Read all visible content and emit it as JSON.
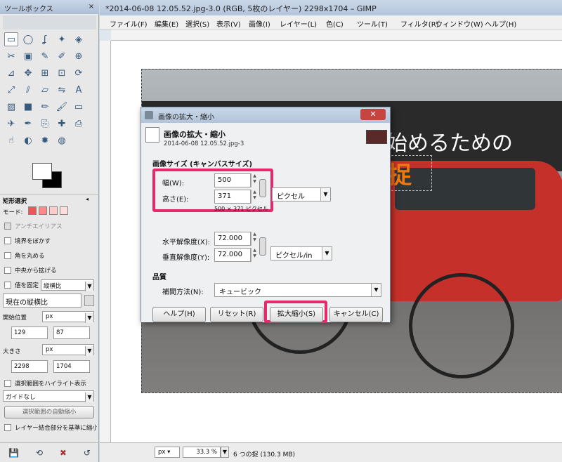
{
  "toolbox": {
    "title": "ツールボックス",
    "close": "×",
    "tools": [
      "rect-select",
      "ellipse-select",
      "free-select",
      "fuzzy-select",
      "color-select",
      "scissors-select",
      "foreground-select",
      "paths",
      "color-picker",
      "zoom",
      "measure",
      "move",
      "align",
      "crop",
      "rotate",
      "scale",
      "shear",
      "perspective",
      "flip",
      "text",
      "bucket-fill",
      "blend",
      "pencil",
      "paintbrush",
      "eraser",
      "airbrush",
      "ink",
      "clone",
      "heal",
      "perspective-clone",
      "smudge",
      "dodge-burn",
      "convolve",
      "blur"
    ],
    "options": {
      "title": "矩形選択",
      "mode_label": "モード:",
      "antialias": "アンチエイリアス",
      "feather": "境界をぼかす",
      "round": "角を丸める",
      "expand_center": "中央から拡げる",
      "fixed": "値を固定",
      "fixed_value": "縦横比",
      "current_ratio": "現在の縦横比",
      "position_label": "開始位置",
      "position_unit": "px",
      "pos_x": "129",
      "pos_y": "87",
      "size_label": "大きさ",
      "size_unit": "px",
      "size_w": "2298",
      "size_h": "1704",
      "highlight": "選択範囲をハイライト表示",
      "guides": "ガイドなし",
      "auto_shrink": "選択範囲の自動縮小",
      "merged": "レイヤー結合部分を基準に縮小"
    }
  },
  "gimp": {
    "title": "*2014-06-08 12.05.52.jpg-3.0 (RGB, 5枚のレイヤー) 2298x1704 – GIMP",
    "menus": [
      "ファイル(F)",
      "編集(E)",
      "選択(S)",
      "表示(V)",
      "画像(I)",
      "レイヤー(L)",
      "色(C)",
      "ツール(T)",
      "フィルタ(R)",
      "ウィンドウ(W)",
      "ヘルプ(H)"
    ],
    "canvas_text_white": "始めるための",
    "canvas_text_orange": "捉",
    "status": {
      "unit": "px",
      "zoom": "33.3 %",
      "info": "6 つの捉 (130.3 MB)"
    }
  },
  "dialog": {
    "title": "画像の拡大・縮小",
    "close": "✕",
    "header": "画像の拡大・縮小",
    "subtitle": "2014-06-08 12.05.52.jpg-3",
    "size_section": "画像サイズ (キャンバスサイズ)",
    "width_label": "幅(W):",
    "width_value": "500",
    "height_label": "高さ(E):",
    "height_value": "371",
    "size_hint": "500 × 371 ピクセル",
    "size_unit": "ピクセル",
    "xres_label": "水平解像度(X):",
    "xres_value": "72.000",
    "yres_label": "垂直解像度(Y):",
    "yres_value": "72.000",
    "res_unit": "ピクセル/in",
    "quality_section": "品質",
    "interp_label": "補間方法(N):",
    "interp_value": "キュービック",
    "help_button": "ヘルプ(H)",
    "reset_button": "リセット(R)",
    "scale_button": "拡大縮小(S)",
    "cancel_button": "キャンセル(C)"
  },
  "colors": {
    "highlight": "#e5296a",
    "car_red": "#c5312a",
    "orange_text": "#f07a10"
  }
}
